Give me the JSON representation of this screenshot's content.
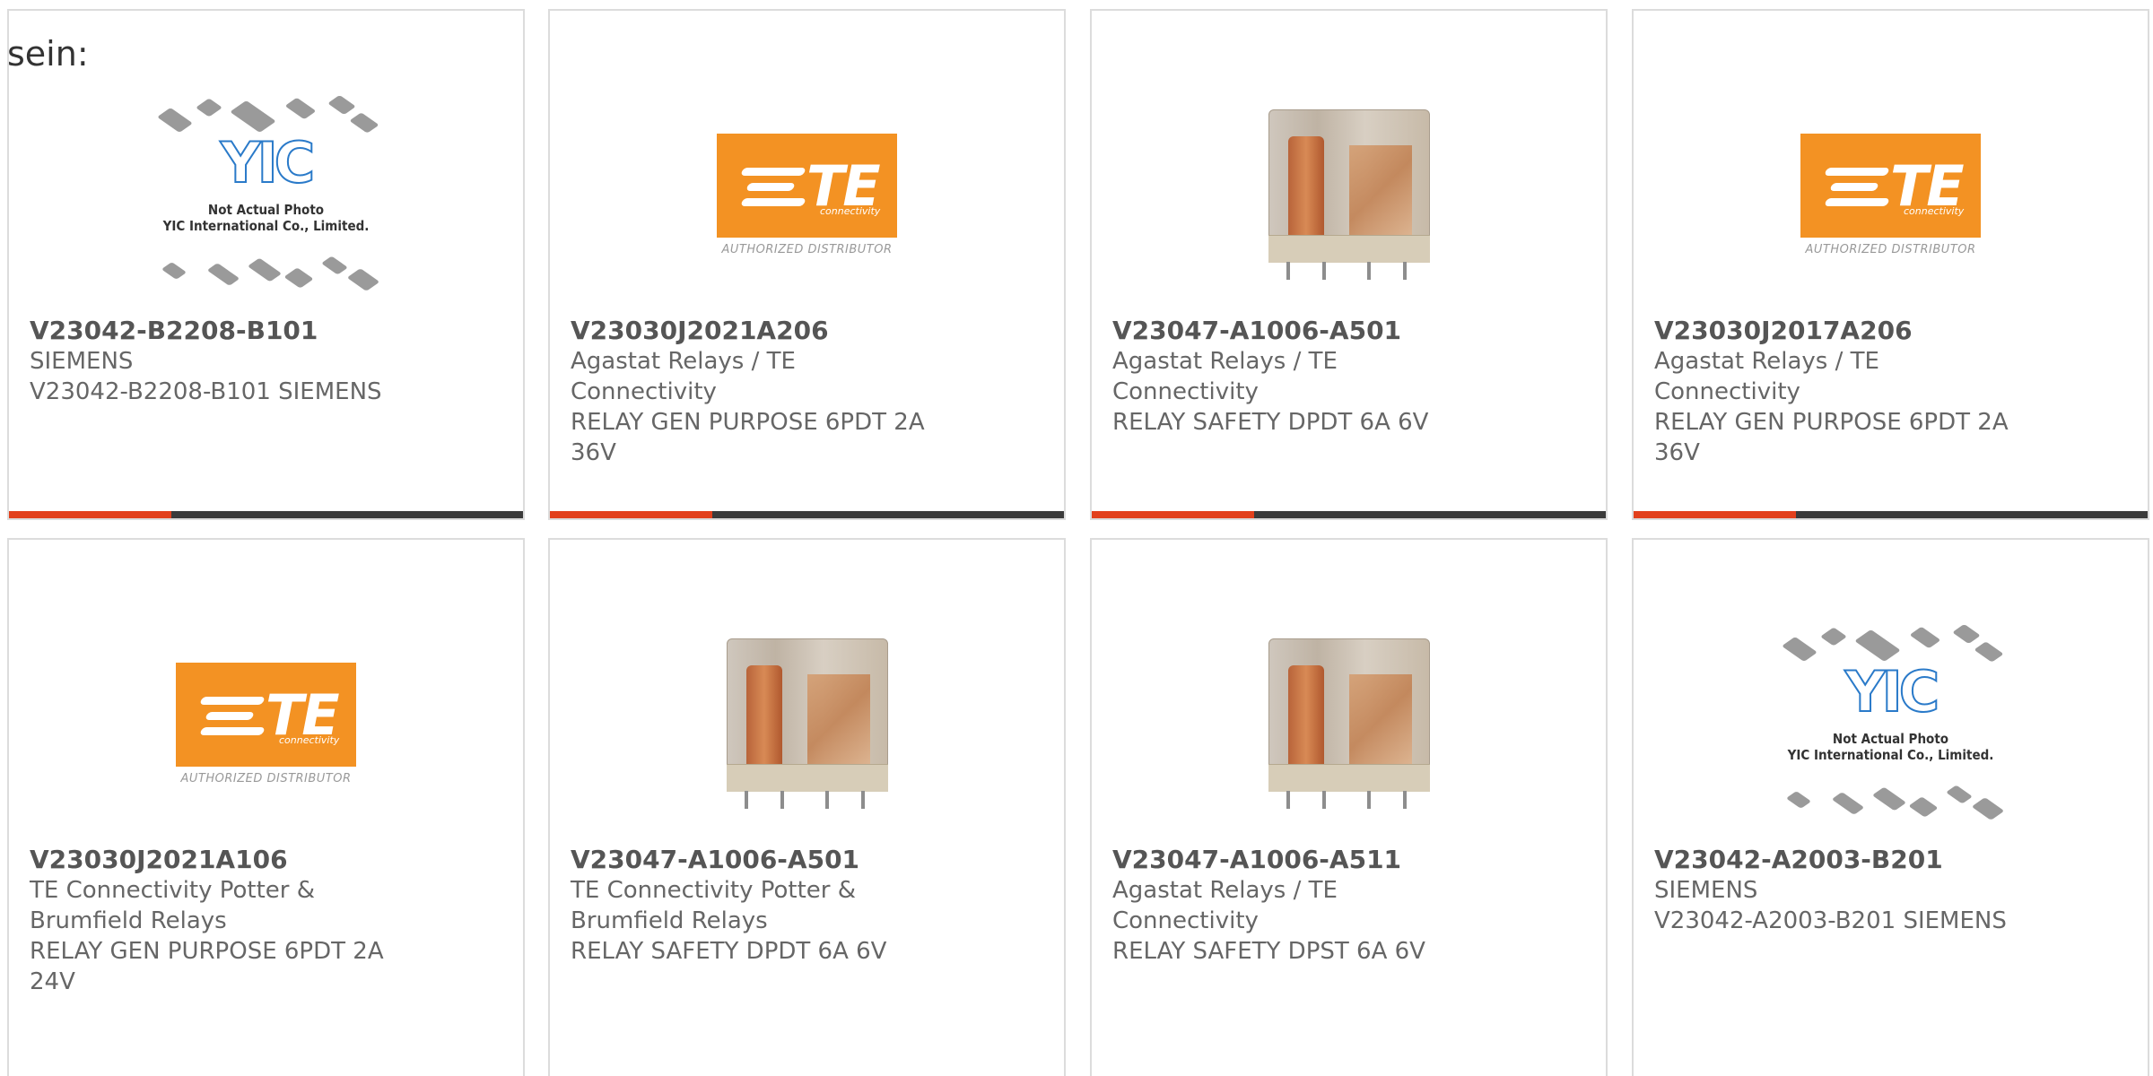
{
  "intro_text": "sein:",
  "brand_colors": {
    "accent": "#e2401c",
    "bar": "#3b3b3b",
    "te_orange": "#f39223"
  },
  "te_logo": {
    "letters": "TE",
    "sub": "connectivity",
    "distributor": "AUTHORIZED DISTRIBUTOR"
  },
  "yic_placeholder": {
    "logo": "YIC",
    "caption_line1": "Not Actual Photo",
    "caption_line2": "YIC International Co., Limited."
  },
  "products": [
    {
      "image": "yic-placeholder",
      "part_number": "V23042-B2208-B101",
      "manufacturer": "SIEMENS",
      "desc1": "V23042-B2208-B101 SIEMENS",
      "desc2": ""
    },
    {
      "image": "te-logo",
      "part_number": "V23030J2021A206",
      "manufacturer": "Agastat Relays / TE Connectivity",
      "desc1": "RELAY GEN PURPOSE 6PDT 2A",
      "desc2": "36V"
    },
    {
      "image": "relay-photo",
      "part_number": "V23047-A1006-A501",
      "manufacturer": "Agastat Relays / TE Connectivity",
      "desc1": "RELAY SAFETY DPDT 6A 6V",
      "desc2": ""
    },
    {
      "image": "te-logo",
      "part_number": "V23030J2017A206",
      "manufacturer": "Agastat Relays / TE Connectivity",
      "desc1": "RELAY GEN PURPOSE 6PDT 2A",
      "desc2": "36V"
    },
    {
      "image": "te-logo",
      "part_number": "V23030J2021A106",
      "manufacturer1": "TE Connectivity Potter &",
      "manufacturer2": "Brumfield Relays",
      "desc1": "RELAY GEN PURPOSE 6PDT 2A",
      "desc2": "24V"
    },
    {
      "image": "relay-photo",
      "part_number": "V23047-A1006-A501",
      "manufacturer1": "TE Connectivity Potter &",
      "manufacturer2": "Brumfield Relays",
      "desc1": "RELAY SAFETY DPDT 6A 6V"
    },
    {
      "image": "relay-photo",
      "part_number": "V23047-A1006-A511",
      "manufacturer": "Agastat Relays / TE Connectivity",
      "desc1": "RELAY SAFETY DPST 6A 6V",
      "desc2": ""
    },
    {
      "image": "yic-placeholder",
      "part_number": "V23042-A2003-B201",
      "manufacturer": "SIEMENS",
      "desc1": "V23042-A2003-B201 SIEMENS",
      "desc2": ""
    }
  ]
}
